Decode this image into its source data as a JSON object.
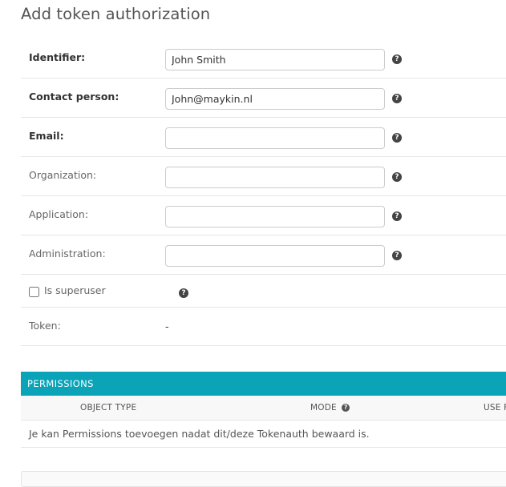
{
  "page": {
    "title": "Add token authorization"
  },
  "form": {
    "fields": [
      {
        "label": "Identifier:",
        "value": "John Smith",
        "required": true
      },
      {
        "label": "Contact person:",
        "value": "John@maykin.nl",
        "required": true
      },
      {
        "label": "Email:",
        "value": "",
        "required": true
      },
      {
        "label": "Organization:",
        "value": "",
        "required": false
      },
      {
        "label": "Application:",
        "value": "",
        "required": false
      },
      {
        "label": "Administration:",
        "value": "",
        "required": false
      }
    ],
    "superuser": {
      "label": "Is superuser",
      "checked": false
    },
    "token": {
      "label": "Token:",
      "value": "-"
    },
    "help_glyph": "?"
  },
  "permissions": {
    "header": "PERMISSIONS",
    "columns": {
      "object_type": "OBJECT TYPE",
      "mode": "MODE",
      "use": "USE F"
    },
    "message": "Je kan Permissions toevoegen nadat dit/deze Tokenauth bewaard is."
  },
  "colors": {
    "accent": "#0aa3b8",
    "help_icon": "#444444"
  }
}
